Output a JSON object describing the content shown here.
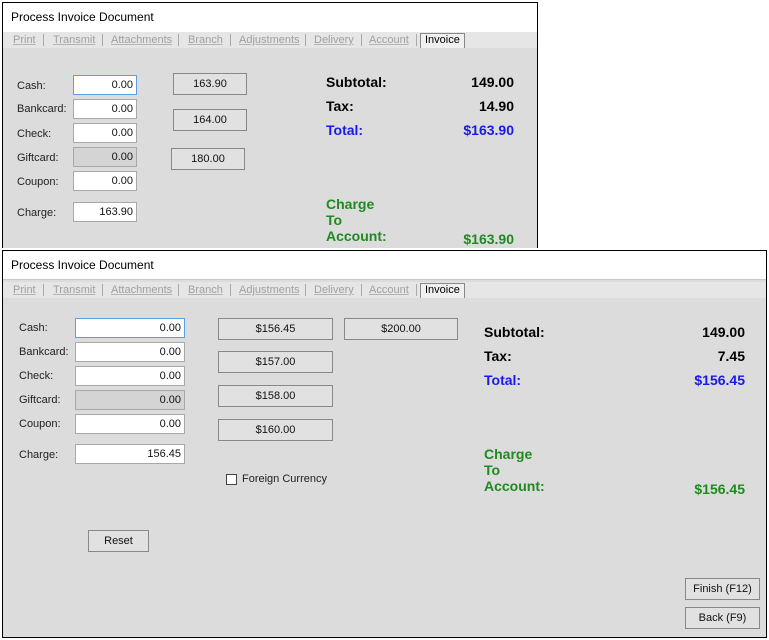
{
  "window1": {
    "title": "Process Invoice Document",
    "tabs": [
      "Print",
      "Transmit",
      "Attachments",
      "Branch",
      "Adjustments",
      "Delivery",
      "Account",
      "Invoice"
    ],
    "fields": [
      {
        "label": "Cash:",
        "value": "0.00"
      },
      {
        "label": "Bankcard:",
        "value": "0.00"
      },
      {
        "label": "Check:",
        "value": "0.00"
      },
      {
        "label": "Giftcard:",
        "value": "0.00"
      },
      {
        "label": "Coupon:",
        "value": "0.00"
      },
      {
        "label": "Charge:",
        "value": "163.90"
      }
    ],
    "quick_amounts": [
      "163.90",
      "164.00",
      "180.00"
    ],
    "subtotal_label": "Subtotal:",
    "subtotal": "149.00",
    "tax_label": "Tax:",
    "tax": "14.90",
    "total_label": "Total:",
    "total": "$163.90",
    "charge_label_1": "Charge",
    "charge_label_2": "To",
    "charge_label_3": "Account:",
    "charge_amount": "$163.90"
  },
  "window2": {
    "title": "Process Invoice Document",
    "tabs": [
      "Print",
      "Transmit",
      "Attachments",
      "Branch",
      "Adjustments",
      "Delivery",
      "Account",
      "Invoice"
    ],
    "fields": [
      {
        "label": "Cash:",
        "value": "0.00"
      },
      {
        "label": "Bankcard:",
        "value": "0.00"
      },
      {
        "label": "Check:",
        "value": "0.00"
      },
      {
        "label": "Giftcard:",
        "value": "0.00"
      },
      {
        "label": "Coupon:",
        "value": "0.00"
      },
      {
        "label": "Charge:",
        "value": "156.45"
      }
    ],
    "quick_amounts": [
      "$156.45",
      "$157.00",
      "$158.00",
      "$160.00",
      "$200.00"
    ],
    "foreign_currency_label": "Foreign Currency",
    "foreign_currency_checked": false,
    "subtotal_label": "Subtotal:",
    "subtotal": "149.00",
    "tax_label": "Tax:",
    "tax": "7.45",
    "total_label": "Total:",
    "total": "$156.45",
    "charge_label_1": "Charge",
    "charge_label_2": "To",
    "charge_label_3": "Account:",
    "charge_amount": "$156.45",
    "reset_label": "Reset",
    "finish_label": "Finish (F12)",
    "back_label": "Back (F9)"
  },
  "colors": {
    "total": "#1a1ae6",
    "charge": "#1f8a1f",
    "panel": "#dcdcdc"
  }
}
